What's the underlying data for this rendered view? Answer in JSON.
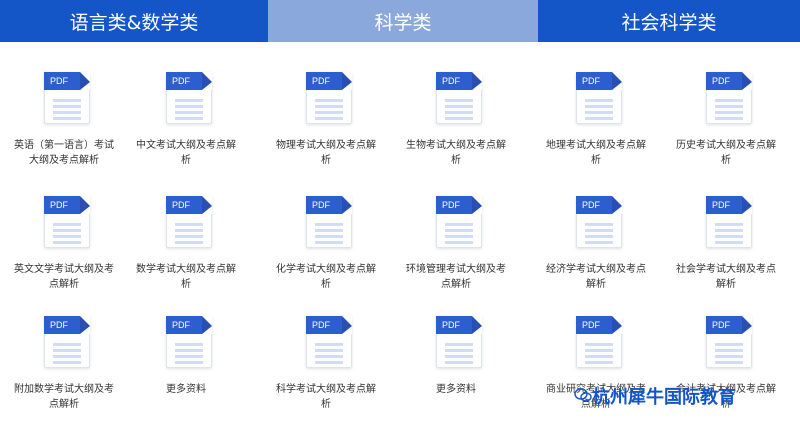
{
  "tabs": [
    {
      "label": "语言类&数学类"
    },
    {
      "label": "科学类"
    },
    {
      "label": "社会科学类"
    }
  ],
  "doc_badge": "PDF",
  "items": [
    {
      "label": "英语（第一语言）考试大纲及考点解析"
    },
    {
      "label": "中文考试大纲及考点解析"
    },
    {
      "label": "物理考试大纲及考点解析"
    },
    {
      "label": "生物考试大纲及考点解析"
    },
    {
      "label": "地理考试大纲及考点解析"
    },
    {
      "label": "历史考试大纲及考点解析"
    },
    {
      "label": "英文文学考试大纲及考点解析"
    },
    {
      "label": "数学考试大纲及考点解析"
    },
    {
      "label": "化学考试大纲及考点解析"
    },
    {
      "label": "环境管理考试大纲及考点解析"
    },
    {
      "label": "经济学考试大纲及考点解析"
    },
    {
      "label": "社会学考试大纲及考点解析"
    },
    {
      "label": "附加数学考试大纲及考点解析"
    },
    {
      "label": "更多资料"
    },
    {
      "label": "科学考试大纲及考点解析"
    },
    {
      "label": "更多资料"
    },
    {
      "label": "商业研究考试大纲及考点解析"
    },
    {
      "label": "会计考试大纲及考点解析"
    }
  ],
  "watermark": "杭州犀牛国际教育",
  "colors": {
    "tab_active": "#1455c8",
    "tab_selected": "#8ba8dc",
    "pdf_blue": "#2d5ed0"
  }
}
